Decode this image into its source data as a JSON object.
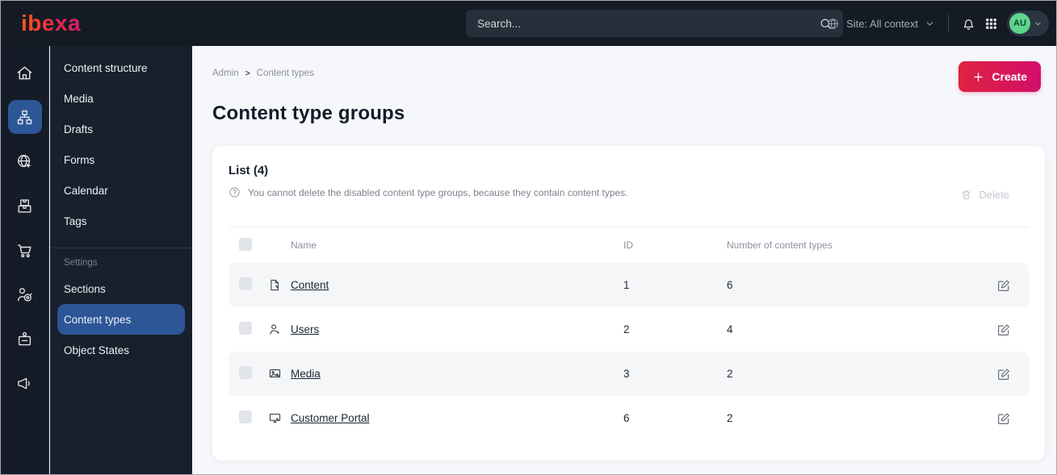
{
  "topbar": {
    "logo_text": "ibexa",
    "search_placeholder": "Search...",
    "site_label": "Site: All context",
    "avatar_initials": "AU"
  },
  "sidebar": {
    "menu_items": [
      "Content structure",
      "Media",
      "Drafts",
      "Forms",
      "Calendar",
      "Tags"
    ],
    "settings_label": "Settings",
    "settings_items": [
      "Sections",
      "Content types",
      "Object States"
    ],
    "active_item": "Content types"
  },
  "breadcrumb": {
    "items": [
      "Admin",
      "Content types"
    ],
    "separator": ">"
  },
  "page": {
    "title": "Content type groups",
    "create_button": "Create"
  },
  "list": {
    "title": "List (4)",
    "info_text": "You cannot delete the disabled content type groups, because they contain content types.",
    "delete_button": "Delete",
    "columns": {
      "name": "Name",
      "id": "ID",
      "count": "Number of content types"
    },
    "rows": [
      {
        "name": "Content",
        "id": "1",
        "count": "6",
        "icon": "file-icon"
      },
      {
        "name": "Users",
        "id": "2",
        "count": "4",
        "icon": "user-icon"
      },
      {
        "name": "Media",
        "id": "3",
        "count": "2",
        "icon": "image-icon"
      },
      {
        "name": "Customer Portal",
        "id": "6",
        "count": "2",
        "icon": "monitor-icon"
      }
    ]
  },
  "icons": {
    "topbar": [
      "search-icon",
      "globe-icon",
      "chevron-down-icon",
      "bell-icon",
      "app-grid-icon",
      "avatar",
      "chevron-down-icon"
    ],
    "rail": [
      "home-icon",
      "sitemap-icon",
      "globe-cursor-icon",
      "packages-icon",
      "cart-icon",
      "target-user-icon",
      "badge-icon",
      "megaphone-icon"
    ],
    "card": [
      "question-circle-icon",
      "trash-icon",
      "edit-icon"
    ],
    "row_types": [
      "file-icon",
      "user-icon",
      "image-icon",
      "monitor-icon"
    ],
    "create": "plus-icon"
  },
  "colors": {
    "topbar_bg": "#141b25",
    "sidebar_bg": "#17202c",
    "active_blue": "#2d5697",
    "brand_gradient": [
      "#ff5a19",
      "#e62a45",
      "#d41d6d"
    ],
    "create_gradient": [
      "#de2341",
      "#d30e6b"
    ],
    "avatar_green": "#5ed48c",
    "main_bg": "#f6f7fa",
    "row_alt_bg": "#f5f6f8"
  }
}
